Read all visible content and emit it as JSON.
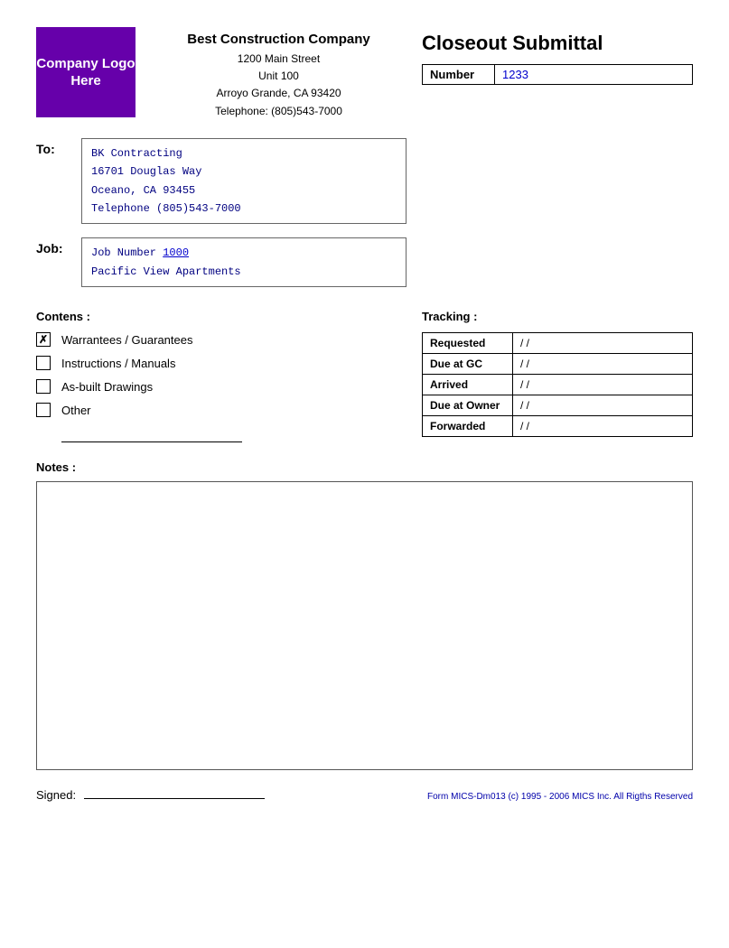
{
  "logo": {
    "text": "Company Logo Here",
    "bg_color": "#6600aa"
  },
  "company": {
    "name": "Best Construction Company",
    "address1": "1200 Main Street",
    "address2": "Unit 100",
    "address3": "Arroyo Grande, CA 93420",
    "phone": "Telephone: (805)543-7000"
  },
  "submittal": {
    "title": "Closeout Submittal",
    "number_label": "Number",
    "number_value": "1233"
  },
  "to_section": {
    "label": "To:",
    "line1": "BK Contracting",
    "line2": "16701 Douglas Way",
    "line3": "Oceano, CA  93455",
    "line4": "Telephone (805)543-7000"
  },
  "job_section": {
    "label": "Job:",
    "line1_prefix": "Job Number ",
    "job_number": "1000",
    "line2": "Pacific View Apartments"
  },
  "contents": {
    "label": "Contens :",
    "items": [
      {
        "label": "Warrantees / Guarantees",
        "checked": true
      },
      {
        "label": "Instructions / Manuals",
        "checked": false
      },
      {
        "label": "As-built Drawings",
        "checked": false
      },
      {
        "label": "Other",
        "checked": false
      }
    ]
  },
  "tracking": {
    "label": "Tracking :",
    "rows": [
      {
        "field": "Requested",
        "value": "/ /"
      },
      {
        "field": "Due at GC",
        "value": "/ /"
      },
      {
        "field": "Arrived",
        "value": "/ /"
      },
      {
        "field": "Due at Owner",
        "value": "/ /"
      },
      {
        "field": "Forwarded",
        "value": "/ /"
      }
    ]
  },
  "notes": {
    "label": "Notes :"
  },
  "footer": {
    "signed_label": "Signed:",
    "copyright": "Form MICS-Dm013 (c) 1995 - 2006 MICS Inc. All Rigths Reserved"
  }
}
